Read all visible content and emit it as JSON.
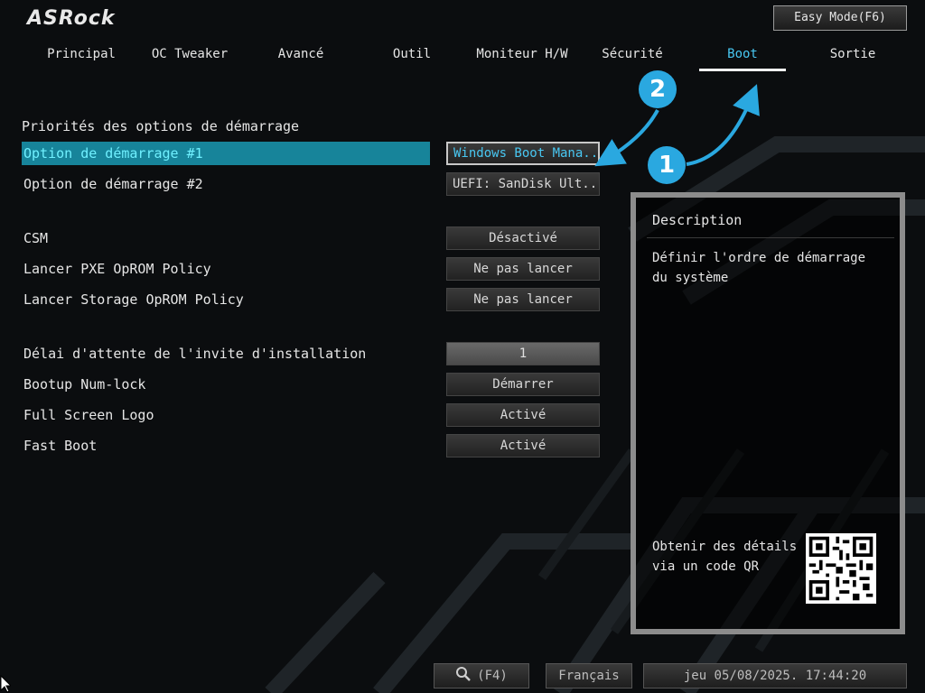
{
  "header": {
    "logo": "ASRock",
    "easy_mode_label": "Easy Mode(F6)"
  },
  "tabs": [
    {
      "label": "Principal",
      "active": false
    },
    {
      "label": "OC Tweaker",
      "active": false
    },
    {
      "label": "Avancé",
      "active": false
    },
    {
      "label": "Outil",
      "active": false
    },
    {
      "label": "Moniteur H/W",
      "active": false
    },
    {
      "label": "Sécurité",
      "active": false
    },
    {
      "label": "Boot",
      "active": true
    },
    {
      "label": "Sortie",
      "active": false
    }
  ],
  "main": {
    "section_title": "Priorités des options de démarrage",
    "settings": [
      {
        "label": "Option de démarrage #1",
        "value": "Windows Boot Mana..."
      },
      {
        "label": "Option de démarrage #2",
        "value": "UEFI: SanDisk Ult..."
      },
      {
        "label": "CSM",
        "value": "Désactivé"
      },
      {
        "label": "Lancer PXE OpROM Policy",
        "value": "Ne pas lancer"
      },
      {
        "label": "Lancer Storage OpROM Policy",
        "value": "Ne pas lancer"
      },
      {
        "label": "Délai d'attente de l'invite d'installation",
        "value": "1"
      },
      {
        "label": "Bootup Num-lock",
        "value": "Démarrer"
      },
      {
        "label": "Full Screen Logo",
        "value": "Activé"
      },
      {
        "label": "Fast Boot",
        "value": "Activé"
      }
    ]
  },
  "description": {
    "title": "Description",
    "text": "Définir l'ordre de démarrage du système",
    "qr_label": "Obtenir des détails via un code QR"
  },
  "annotations": {
    "badge_1": "1",
    "badge_2": "2",
    "color": "#2aa8e0"
  },
  "footer": {
    "search_label": "(F4)",
    "language": "Français",
    "datetime": "jeu 05/08/2025. 17:44:20"
  },
  "colors": {
    "accent": "#48c7f2",
    "selected_row_bg": "#17849a",
    "selected_row_text": "#6ff0ff"
  }
}
